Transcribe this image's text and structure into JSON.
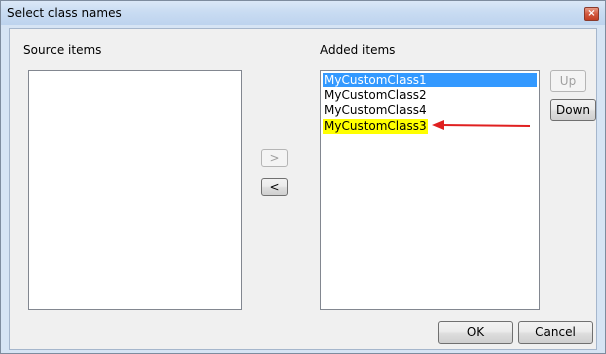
{
  "window": {
    "title": "Select class names",
    "close_glyph": "×"
  },
  "source": {
    "label": "Source items",
    "items": []
  },
  "added": {
    "label": "Added items",
    "items": [
      "MyCustomClass1",
      "MyCustomClass2",
      "MyCustomClass4",
      "MyCustomClass3"
    ],
    "selected_index": 0,
    "highlighted_index": 3
  },
  "buttons": {
    "add": ">",
    "remove": "<",
    "up": "Up",
    "down": "Down",
    "ok": "OK",
    "cancel": "Cancel"
  },
  "colors": {
    "selection": "#3399ff",
    "highlight": "#ffff00",
    "annotation_arrow": "#e02020"
  }
}
